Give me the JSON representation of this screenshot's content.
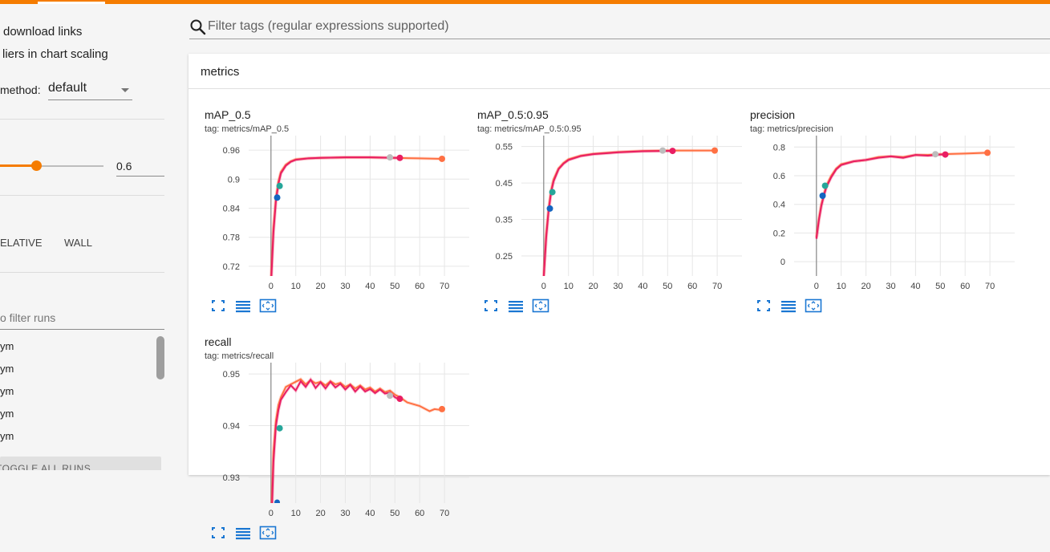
{
  "sidebar": {
    "download_links": "download links",
    "outliers": "liers in chart scaling",
    "method_label": "method:",
    "method_value": "default",
    "smoothing_value": "0.6",
    "xaxis": {
      "relative": "ELATIVE",
      "wall": "WALL"
    },
    "run_filter_placeholder": "o filter runs",
    "runs": [
      "ym",
      "ym",
      "ym",
      "ym",
      "ym"
    ],
    "toggle_all_runs": "TOGGLE ALL RUNS"
  },
  "filter": {
    "placeholder": "Filter tags (regular expressions supported)"
  },
  "section": {
    "title": "metrics"
  },
  "colors": {
    "accent": "#f57c00",
    "run_orange": "#ff7043",
    "run_pink": "#e91e63",
    "run_blue": "#1565c0",
    "run_teal": "#26a69a",
    "run_gray": "#9e9e9e"
  },
  "icons": [
    "search-icon",
    "fit-to-screen-icon",
    "toggle-log-scale-icon",
    "expand-icon"
  ],
  "chart_data": [
    {
      "type": "line",
      "title": "mAP_0.5",
      "tag": "tag: metrics/mAP_0.5",
      "xticks": [
        0,
        10,
        20,
        30,
        40,
        50,
        60,
        70
      ],
      "yticks": [
        "0.72",
        "0.78",
        "0.84",
        "0.9",
        "0.96"
      ],
      "ytick_values": [
        0.72,
        0.78,
        0.84,
        0.9,
        0.96
      ],
      "ylim": [
        0.7,
        0.99
      ],
      "xlim": [
        -9,
        80
      ],
      "grid": true,
      "series": [
        {
          "color": "#ff7043",
          "x": [
            0,
            1,
            2,
            3,
            4,
            6,
            8,
            10,
            15,
            20,
            30,
            40,
            50,
            60,
            69
          ],
          "y": [
            0.69,
            0.8,
            0.86,
            0.895,
            0.915,
            0.93,
            0.937,
            0.941,
            0.943,
            0.944,
            0.945,
            0.945,
            0.944,
            0.943,
            0.942
          ]
        },
        {
          "color": "#e91e63",
          "x": [
            0,
            1,
            2,
            3,
            4,
            6,
            8,
            10,
            15,
            20,
            30,
            40,
            50,
            52
          ],
          "y": [
            0.68,
            0.79,
            0.855,
            0.89,
            0.912,
            0.928,
            0.936,
            0.94,
            0.943,
            0.944,
            0.945,
            0.945,
            0.944,
            0.944
          ]
        }
      ],
      "markers": [
        {
          "x": 2.5,
          "y": 0.862,
          "color": "#1565c0"
        },
        {
          "x": 3.5,
          "y": 0.886,
          "color": "#26a69a"
        },
        {
          "x": 48,
          "y": 0.945,
          "color": "#bdbdbd"
        },
        {
          "x": 52,
          "y": 0.944,
          "color": "#e91e63"
        },
        {
          "x": 69,
          "y": 0.942,
          "color": "#ff7043"
        }
      ]
    },
    {
      "type": "line",
      "title": "mAP_0.5:0.95",
      "tag": "tag: metrics/mAP_0.5:0.95",
      "xticks": [
        0,
        10,
        20,
        30,
        40,
        50,
        60,
        70
      ],
      "yticks": [
        "0.25",
        "0.35",
        "0.45",
        "0.55"
      ],
      "ytick_values": [
        0.25,
        0.35,
        0.45,
        0.55
      ],
      "ylim": [
        0.195,
        0.58
      ],
      "xlim": [
        -9,
        80
      ],
      "grid": true,
      "series": [
        {
          "color": "#ff7043",
          "x": [
            0,
            1,
            2,
            3,
            4,
            6,
            8,
            10,
            15,
            20,
            30,
            40,
            50,
            60,
            69
          ],
          "y": [
            0.19,
            0.31,
            0.38,
            0.43,
            0.46,
            0.49,
            0.505,
            0.515,
            0.525,
            0.53,
            0.535,
            0.538,
            0.539,
            0.539,
            0.539
          ]
        },
        {
          "color": "#e91e63",
          "x": [
            0,
            1,
            2,
            3,
            4,
            6,
            8,
            10,
            15,
            20,
            30,
            40,
            50,
            52
          ],
          "y": [
            0.19,
            0.3,
            0.375,
            0.425,
            0.455,
            0.488,
            0.503,
            0.513,
            0.524,
            0.529,
            0.534,
            0.537,
            0.538,
            0.538
          ]
        }
      ],
      "markers": [
        {
          "x": 2.5,
          "y": 0.38,
          "color": "#1565c0"
        },
        {
          "x": 3.5,
          "y": 0.425,
          "color": "#26a69a"
        },
        {
          "x": 48,
          "y": 0.539,
          "color": "#bdbdbd"
        },
        {
          "x": 52,
          "y": 0.538,
          "color": "#e91e63"
        },
        {
          "x": 69,
          "y": 0.539,
          "color": "#ff7043"
        }
      ]
    },
    {
      "type": "line",
      "title": "precision",
      "tag": "tag: metrics/precision",
      "xticks": [
        0,
        10,
        20,
        30,
        40,
        50,
        60,
        70
      ],
      "yticks": [
        "0",
        "0.2",
        "0.4",
        "0.6",
        "0.8"
      ],
      "ytick_values": [
        0,
        0.2,
        0.4,
        0.6,
        0.8
      ],
      "ylim": [
        -0.1,
        0.88
      ],
      "xlim": [
        -9,
        80
      ],
      "grid": true,
      "series": [
        {
          "color": "#ff7043",
          "x": [
            0,
            1,
            2,
            3,
            4,
            6,
            8,
            10,
            15,
            20,
            25,
            30,
            35,
            40,
            45,
            50,
            60,
            69
          ],
          "y": [
            0.17,
            0.3,
            0.4,
            0.47,
            0.53,
            0.6,
            0.65,
            0.68,
            0.7,
            0.71,
            0.73,
            0.735,
            0.73,
            0.745,
            0.745,
            0.75,
            0.755,
            0.76
          ]
        },
        {
          "color": "#e91e63",
          "x": [
            0,
            1,
            2,
            3,
            4,
            6,
            8,
            10,
            15,
            20,
            25,
            30,
            35,
            40,
            45,
            50,
            52
          ],
          "y": [
            0.16,
            0.29,
            0.39,
            0.46,
            0.52,
            0.59,
            0.645,
            0.675,
            0.7,
            0.71,
            0.725,
            0.735,
            0.725,
            0.745,
            0.74,
            0.748,
            0.748
          ]
        }
      ],
      "markers": [
        {
          "x": 2.5,
          "y": 0.46,
          "color": "#1565c0"
        },
        {
          "x": 3.5,
          "y": 0.53,
          "color": "#26a69a"
        },
        {
          "x": 48,
          "y": 0.75,
          "color": "#bdbdbd"
        },
        {
          "x": 52,
          "y": 0.748,
          "color": "#e91e63"
        },
        {
          "x": 69,
          "y": 0.76,
          "color": "#ff7043"
        }
      ]
    },
    {
      "type": "line",
      "title": "recall",
      "tag": "tag: metrics/recall",
      "xticks": [
        0,
        10,
        20,
        30,
        40,
        50,
        60,
        70
      ],
      "yticks": [
        "0.93",
        "0.94",
        "0.95"
      ],
      "ytick_values": [
        0.93,
        0.94,
        0.95
      ],
      "ylim": [
        0.925,
        0.9522
      ],
      "xlim": [
        -9,
        80
      ],
      "grid": true,
      "series": [
        {
          "color": "#ff7043",
          "x": [
            0,
            1,
            2,
            3,
            4,
            6,
            8,
            10,
            12,
            14,
            16,
            18,
            20,
            22,
            24,
            26,
            28,
            30,
            32,
            34,
            36,
            38,
            40,
            42,
            44,
            46,
            48,
            50,
            52,
            55,
            60,
            64,
            66,
            69
          ],
          "y": [
            0.92,
            0.935,
            0.941,
            0.944,
            0.9455,
            0.9475,
            0.948,
            0.9485,
            0.949,
            0.948,
            0.9488,
            0.9482,
            0.9485,
            0.9478,
            0.9486,
            0.948,
            0.9483,
            0.9475,
            0.948,
            0.9472,
            0.9478,
            0.947,
            0.9474,
            0.9466,
            0.9472,
            0.9465,
            0.9468,
            0.946,
            0.9455,
            0.9445,
            0.9438,
            0.9428,
            0.9432,
            0.943
          ]
        },
        {
          "color": "#e91e63",
          "x": [
            0,
            1,
            2,
            3,
            4,
            6,
            8,
            10,
            12,
            14,
            16,
            18,
            20,
            22,
            24,
            26,
            28,
            30,
            32,
            34,
            36,
            38,
            40,
            42,
            44,
            46,
            48,
            50,
            52
          ],
          "y": [
            0.918,
            0.933,
            0.94,
            0.943,
            0.945,
            0.9465,
            0.9478,
            0.9468,
            0.9486,
            0.9475,
            0.9489,
            0.9473,
            0.9484,
            0.9472,
            0.9485,
            0.9474,
            0.9481,
            0.947,
            0.9479,
            0.9466,
            0.9476,
            0.9466,
            0.9471,
            0.9463,
            0.947,
            0.9462,
            0.9464,
            0.9455,
            0.945
          ]
        }
      ],
      "markers": [
        {
          "x": 2.5,
          "y": 0.9225,
          "color": "#1565c0"
        },
        {
          "x": 3.5,
          "y": 0.9395,
          "color": "#26a69a"
        },
        {
          "x": 48,
          "y": 0.9458,
          "color": "#bdbdbd"
        },
        {
          "x": 52,
          "y": 0.9452,
          "color": "#e91e63"
        },
        {
          "x": 69,
          "y": 0.9432,
          "color": "#ff7043"
        }
      ]
    }
  ]
}
